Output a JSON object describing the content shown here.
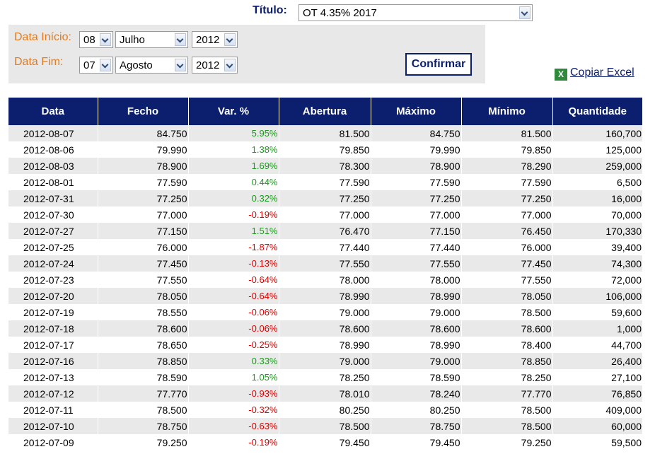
{
  "titulo": {
    "label": "Título:",
    "value": "OT 4.35% 2017"
  },
  "filters": {
    "inicio_label": "Data Início:",
    "fim_label": "Data Fim:",
    "inicio": {
      "day": "08",
      "month": "Julho",
      "year": "2012"
    },
    "fim": {
      "day": "07",
      "month": "Agosto",
      "year": "2012"
    },
    "confirm_label": "Confirmar"
  },
  "excel": {
    "label": "Copiar Excel",
    "icon": "excel-icon"
  },
  "table": {
    "headers": [
      "Data",
      "Fecho",
      "Var. %",
      "Abertura",
      "Máximo",
      "Mínimo",
      "Quantidade"
    ],
    "rows": [
      [
        "2012-08-07",
        "84.750",
        "5.95%",
        "81.500",
        "84.750",
        "81.500",
        "160,700"
      ],
      [
        "2012-08-06",
        "79.990",
        "1.38%",
        "79.850",
        "79.990",
        "79.850",
        "125,000"
      ],
      [
        "2012-08-03",
        "78.900",
        "1.69%",
        "78.300",
        "78.900",
        "78.290",
        "259,000"
      ],
      [
        "2012-08-01",
        "77.590",
        "0.44%",
        "77.590",
        "77.590",
        "77.590",
        "6,500"
      ],
      [
        "2012-07-31",
        "77.250",
        "0.32%",
        "77.250",
        "77.250",
        "77.250",
        "16,000"
      ],
      [
        "2012-07-30",
        "77.000",
        "-0.19%",
        "77.000",
        "77.000",
        "77.000",
        "70,000"
      ],
      [
        "2012-07-27",
        "77.150",
        "1.51%",
        "76.470",
        "77.150",
        "76.450",
        "170,330"
      ],
      [
        "2012-07-25",
        "76.000",
        "-1.87%",
        "77.440",
        "77.440",
        "76.000",
        "39,400"
      ],
      [
        "2012-07-24",
        "77.450",
        "-0.13%",
        "77.550",
        "77.550",
        "77.450",
        "74,300"
      ],
      [
        "2012-07-23",
        "77.550",
        "-0.64%",
        "78.000",
        "78.000",
        "77.550",
        "72,000"
      ],
      [
        "2012-07-20",
        "78.050",
        "-0.64%",
        "78.990",
        "78.990",
        "78.050",
        "106,000"
      ],
      [
        "2012-07-19",
        "78.550",
        "-0.06%",
        "79.000",
        "79.000",
        "78.500",
        "59,600"
      ],
      [
        "2012-07-18",
        "78.600",
        "-0.06%",
        "78.600",
        "78.600",
        "78.600",
        "1,000"
      ],
      [
        "2012-07-17",
        "78.650",
        "-0.25%",
        "78.990",
        "78.990",
        "78.400",
        "44,700"
      ],
      [
        "2012-07-16",
        "78.850",
        "0.33%",
        "79.000",
        "79.000",
        "78.850",
        "26,400"
      ],
      [
        "2012-07-13",
        "78.590",
        "1.05%",
        "78.250",
        "78.590",
        "78.250",
        "27,100"
      ],
      [
        "2012-07-12",
        "77.770",
        "-0.93%",
        "78.010",
        "78.240",
        "77.770",
        "76,850"
      ],
      [
        "2012-07-11",
        "78.500",
        "-0.32%",
        "80.250",
        "80.250",
        "78.500",
        "409,000"
      ],
      [
        "2012-07-10",
        "78.750",
        "-0.63%",
        "78.500",
        "78.750",
        "78.500",
        "60,000"
      ],
      [
        "2012-07-09",
        "79.250",
        "-0.19%",
        "79.450",
        "79.450",
        "79.250",
        "59,500"
      ]
    ]
  },
  "colors": {
    "header_bg": "#0b1f6e",
    "label_orange": "#e07b1f",
    "positive": "#1a9a1a",
    "negative": "#e00000"
  }
}
